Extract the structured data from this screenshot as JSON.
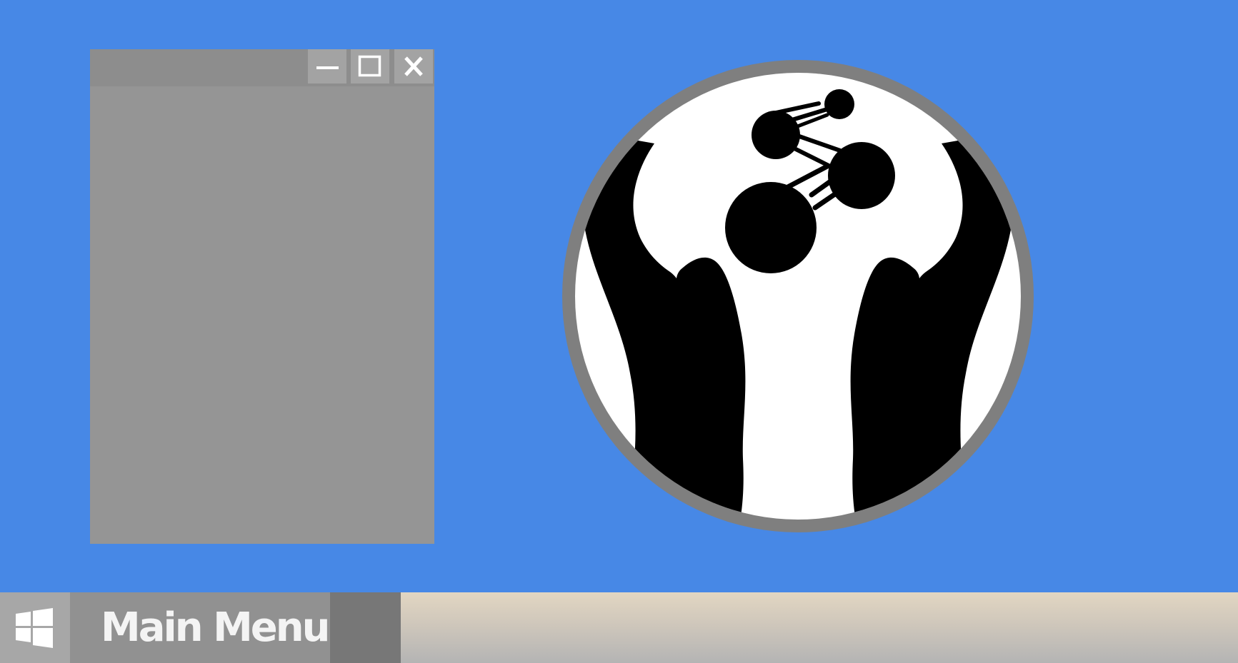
{
  "desktop": {
    "background_color": "#4788e6"
  },
  "window": {
    "title": "",
    "controls": {
      "minimize_icon": "minimize-icon",
      "maximize_icon": "maximize-icon",
      "close_icon": "close-icon"
    },
    "colors": {
      "body": "#959595",
      "titlebar": "#8d8d8d",
      "button": "#a3a3a3"
    }
  },
  "logo": {
    "icon": "hands-holding-molecule-icon",
    "colors": {
      "ring": "#7f7f7f",
      "fill": "#ffffff",
      "figure": "#000000"
    }
  },
  "taskbar": {
    "start_icon": "windows-logo-icon",
    "main_menu_label": "Main Menu",
    "colors": {
      "start_button": "#a7a7a7",
      "main_menu": "#919191",
      "task_slot": "#777777"
    }
  }
}
